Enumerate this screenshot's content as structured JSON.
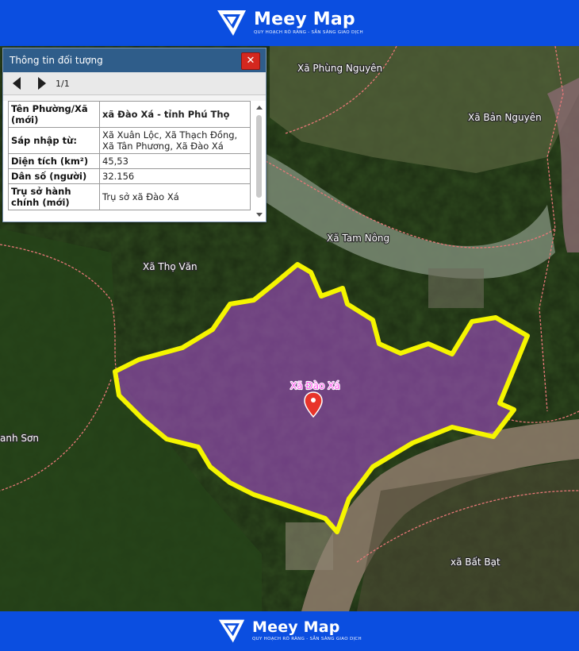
{
  "brand": {
    "name": "Meey Map",
    "tagline": "QUY HOẠCH RÕ RÀNG - SẴN SÀNG GIAO DỊCH"
  },
  "popup": {
    "title": "Thông tin đối tượng",
    "close_label": "✕",
    "page_counter": "1/1",
    "rows": [
      {
        "label": "Tên Phường/Xã (mới)",
        "value": "xã Đào Xá - tỉnh Phú Thọ"
      },
      {
        "label": "Sáp nhập từ:",
        "value": "Xã Xuân Lộc, Xã Thạch Đồng, Xã Tân Phương, Xã Đào Xá"
      },
      {
        "label": "Diện tích (km²)",
        "value": "45,53"
      },
      {
        "label": "Dân số (người)",
        "value": "32.156"
      },
      {
        "label": "Trụ sở hành chính (mới)",
        "value": "Trụ sở xã Đào Xá"
      }
    ]
  },
  "map": {
    "labels": {
      "phung_nguyen": "Xã Phùng Nguyên",
      "ban_nguyen": "Xã Bản Nguyên",
      "tam_nong": "Xã Tam Nông",
      "tho_van": "Xã Thọ Văn",
      "thanh_son": "anh Sơn",
      "dao_xa": "Xã Đào Xá",
      "bat_bat": "xã Bất Bạt"
    },
    "colors": {
      "highlight_border": "#f5f500",
      "highlight_fill": "#b04fd8",
      "marker": "#e8342a",
      "boundary": "#e87878"
    }
  }
}
